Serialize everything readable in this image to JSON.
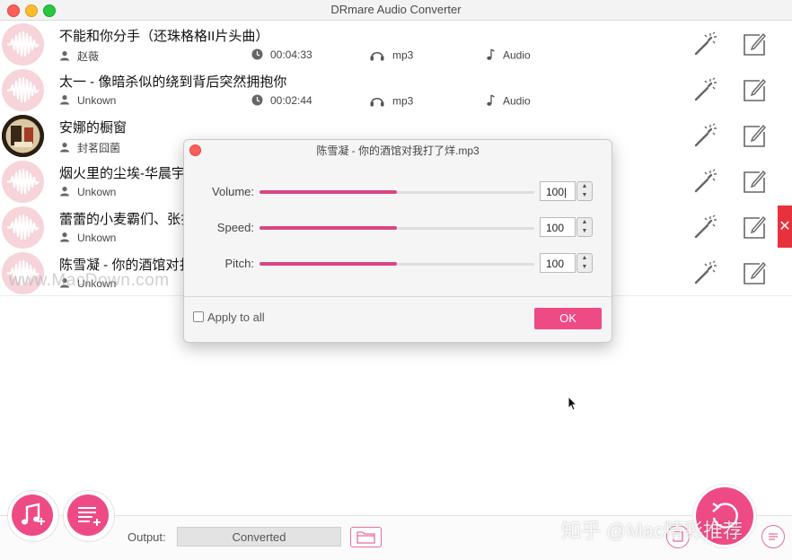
{
  "window": {
    "title": "DRmare Audio Converter"
  },
  "tracks": [
    {
      "title": "不能和你分手（还珠格格II片头曲）",
      "artist": "赵薇",
      "duration": "00:04:33",
      "format": "mp3",
      "type": "Audio",
      "thumb": "wave"
    },
    {
      "title": "太一 - 像暗杀似的绕到背后突然拥抱你",
      "artist": "Unkown",
      "duration": "00:02:44",
      "format": "mp3",
      "type": "Audio",
      "thumb": "wave"
    },
    {
      "title": "安娜的橱窗",
      "artist": "封茗囧菌",
      "thumb": "album"
    },
    {
      "title": "烟火里的尘埃-华晨宇",
      "artist": "Unkown",
      "thumb": "wave"
    },
    {
      "title": "蕾蕾的小麦霸们、张扌",
      "artist": "Unkown",
      "thumb": "wave"
    },
    {
      "title": "陈雪凝 - 你的酒馆对扌",
      "artist": "Unkown",
      "thumb": "wave"
    }
  ],
  "dialog": {
    "title": "陈雪凝 - 你的酒馆对我打了烊.mp3",
    "rows": [
      {
        "label": "Volume:",
        "value": "100|",
        "level": 0.5
      },
      {
        "label": "Speed:",
        "value": "100",
        "level": 0.5
      },
      {
        "label": "Pitch:",
        "value": "100",
        "level": 0.5
      }
    ],
    "apply_all": "Apply to all",
    "ok": "OK"
  },
  "bottom": {
    "output_label": "Output:",
    "output_value": "Converted"
  },
  "watermarks": {
    "macdown": "www.MacDown.com",
    "zhihu": "知乎 @Mac精彩推荐"
  },
  "colors": {
    "accent": "#ee4b86",
    "delete": "#e8313c",
    "slider": "#d94683"
  },
  "icons": {
    "add_music": "music-note-plus-icon",
    "add_list": "list-plus-icon",
    "wand": "magic-wand-icon",
    "edit": "edit-icon",
    "folder": "folder-icon",
    "convert": "convert-icon",
    "delete": "close-icon"
  }
}
